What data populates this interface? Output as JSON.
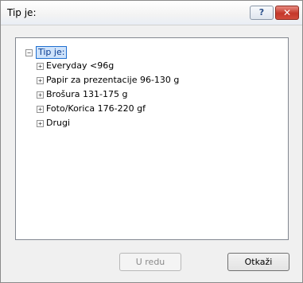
{
  "window": {
    "title": "Tip je:",
    "help_glyph": "?",
    "close_glyph": "✕"
  },
  "tree": {
    "root": {
      "label": "Tip je:",
      "expander": "−"
    },
    "items": [
      {
        "label": "Everyday <96g",
        "expander": "+"
      },
      {
        "label": "Papir za prezentacije 96-130 g",
        "expander": "+"
      },
      {
        "label": "Brošura 131-175 g",
        "expander": "+"
      },
      {
        "label": "Foto/Korica 176-220 gf",
        "expander": "+"
      },
      {
        "label": "Drugi",
        "expander": "+"
      }
    ]
  },
  "buttons": {
    "ok_label": "U redu",
    "cancel_label": "Otkaži"
  }
}
